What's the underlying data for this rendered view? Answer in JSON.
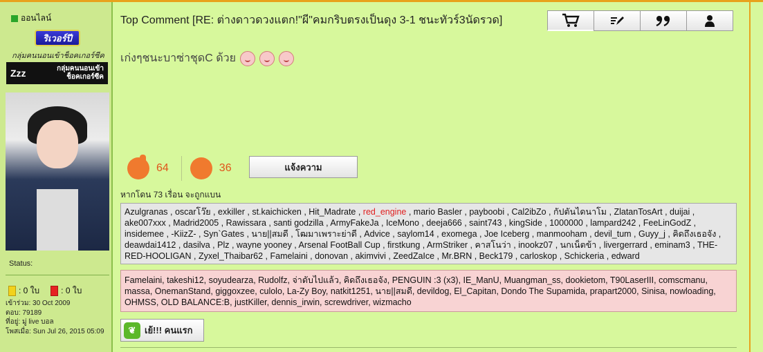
{
  "sidebar": {
    "online_label": "ออนไลน์",
    "badge_text": "ริเวอร์ปี",
    "club_text": "กลุ่มคนนอนเข้าช็อคเกอร์ซีค",
    "zzz_icon": "Zzz",
    "zzz_text_1": "กลุ่มคนนอนเข้า",
    "zzz_text_2": "ช็อคเกอร์ซีค",
    "status_label": "Status:",
    "yellow_cards": ": 0 ใบ",
    "red_cards": ": 0 ใบ",
    "joined": "เข้าร่วม: 30 Oct 2009",
    "answers": "ตอบ: 79189",
    "location": "ที่อยู่: มู่ live บอล",
    "posted": "โพสเมื่อ: Sun Jul 26, 2015 05:09"
  },
  "post": {
    "title": "Top Comment [RE: ต่างดาวดวงแตก!\"ผี\"คมกริบตรงเป็นดุง 3-1 ชนะทัวร์3นัดรวด]",
    "body": "เก่งๆชนะบาซ่าชุดC ด้วย",
    "toolbar_icons": [
      "cart-icon",
      "edit-icon",
      "quote-icon",
      "user-icon"
    ]
  },
  "votes": {
    "up": "64",
    "down": "36",
    "report_label": "แจ้งความ"
  },
  "likers": {
    "count_label": "หากโดน 73 เรื่อน จะถูกแบน",
    "green_list_before": "Azulgranas , oscarโว๊ย , exkiller , st.kaichicken , Hit_Madrate , ",
    "green_highlight": "red_engine",
    "green_list_after": " , mario Basler , payboobi , Cal2ibZo , กัปตันไดนาโม , ZlatanTosArt , duijai , ake007xxx , Madrid2005 , Rawissara , santi godzilla , ArmyFakeJa , IceMono , deeja666 , saint743 , kingSide , 1000000 , lampard242 , FeeLinGodZ , insidemee , -KiizZ- , Syn`Gates , นาย||สมดี , โฒมาเพราะย่าดี , Advice , saylom14 , exomega , Joe Iceberg , manmooham , devil_tum , Guyy_j , คิดถึงเธอจัง , deawdai1412 , dasilva , Plz , wayne yooney , Arsenal FootBall Cup , firstkung , ArmStriker , คาสโนว่า , inookz07 , นกเน็ตข้า , livergerrard , eminam3 , THE-RED-HOOLIGAN , Zyxel_Thaibar62 , Famelaini , donovan , akimvivi , ZeedZaIce , Mr.BRN , Beck179 , carloskop , Schickeria , edward",
    "red_list": "Famelaini, takeshi12, soyudearza, Rudolfz, จ่าดับไปแล้ว, คิดถึงเธอจัง, PENGUIN :3 (x3), IE_ManU, Muangman_ss, dookietom, T90LaserIII, comscmanu, massa, OnemanStand, giggoxzee, culolo, La-Zy Boy, natkit1251, นาย||สมดี, devildog, El_Capitan, Dondo The Supamida, prapart2000, Sinisa, nowloading, OHMSS, OLD BALANCE:B, justKiller, dennis_irwin, screwdriver, wizmacho"
  },
  "first_button": {
    "label": "เย้!!! คนแรก",
    "icon": "leaf-icon"
  }
}
